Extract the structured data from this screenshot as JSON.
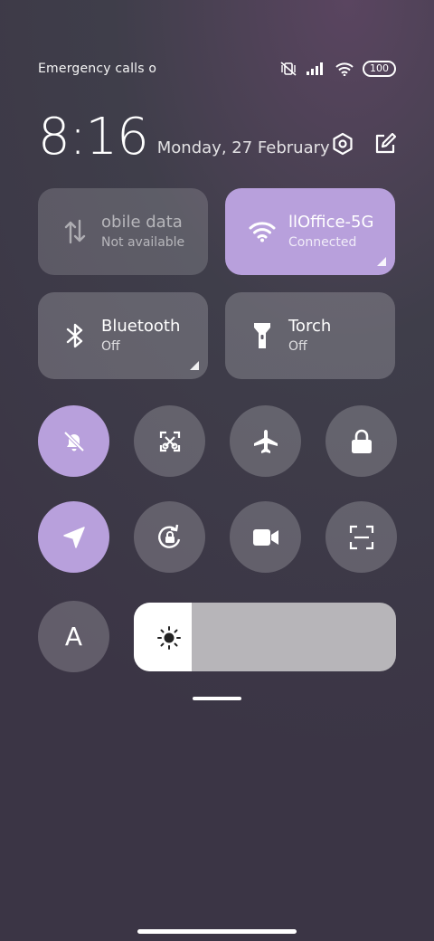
{
  "status_bar": {
    "carrier_text": "Emergency calls o",
    "battery": "100",
    "icons": [
      "vibrate-off-icon",
      "signal-icon",
      "wifi-icon",
      "battery-icon"
    ]
  },
  "header": {
    "time": "8:16",
    "date": "Monday, 27 February",
    "actions": [
      "settings-icon",
      "edit-icon"
    ]
  },
  "tiles": [
    {
      "title": "obile data",
      "subtitle": "Not available",
      "icon": "mobile-data-icon",
      "state": "disabled"
    },
    {
      "title": "llOffice-5G",
      "subtitle": "Connected",
      "icon": "wifi-icon",
      "state": "active"
    },
    {
      "title": "Bluetooth",
      "subtitle": "Off",
      "icon": "bluetooth-icon",
      "state": "off"
    },
    {
      "title": "Torch",
      "subtitle": "Off",
      "icon": "torch-icon",
      "state": "off"
    }
  ],
  "toggles": [
    {
      "icon": "mute-bell-icon",
      "active": true
    },
    {
      "icon": "screenshot-icon",
      "active": false
    },
    {
      "icon": "airplane-icon",
      "active": false
    },
    {
      "icon": "lock-icon",
      "active": false
    },
    {
      "icon": "location-icon",
      "active": true
    },
    {
      "icon": "rotation-lock-icon",
      "active": false
    },
    {
      "icon": "video-camera-icon",
      "active": false
    },
    {
      "icon": "scan-icon",
      "active": false
    }
  ],
  "auto_brightness_label": "A",
  "brightness": {
    "level": 0.22,
    "icon": "sun-icon"
  },
  "colors": {
    "accent": "#b8a0dc"
  }
}
